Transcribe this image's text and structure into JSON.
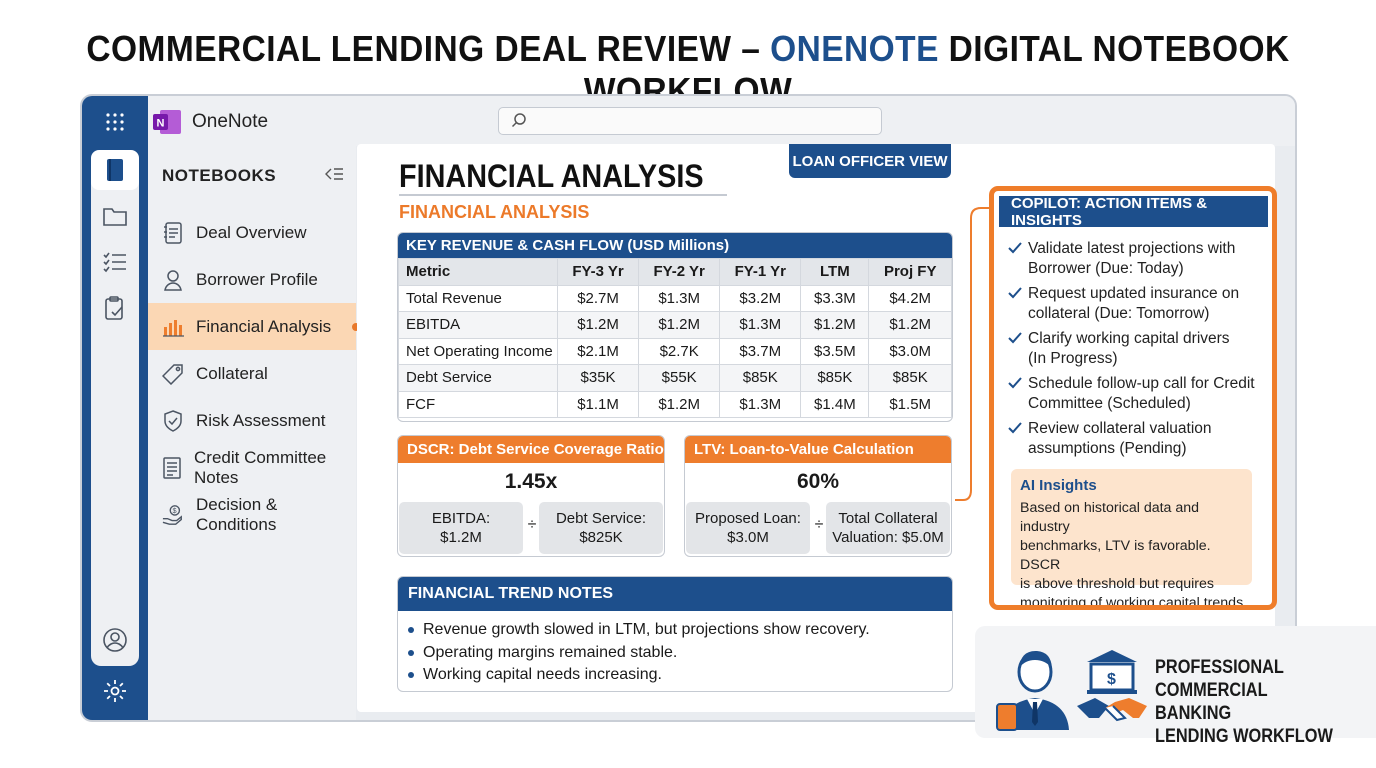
{
  "headline": {
    "part1": "COMMERCIAL LENDING DEAL REVIEW – ",
    "accent": "ONENOTE",
    "part2": " DIGITAL NOTEBOOK WORKFLOW"
  },
  "app": {
    "name": "OneNote",
    "search_placeholder": ""
  },
  "rail": {
    "icons": [
      "apps-grid-icon",
      "notebook-icon",
      "folder-icon",
      "checklist-icon",
      "clipboard-icon",
      "account-icon",
      "settings-icon"
    ]
  },
  "notebooks": {
    "heading": "NOTEBOOKS",
    "items": [
      {
        "label": "Deal Overview",
        "icon": "document-icon"
      },
      {
        "label": "Borrower Profile",
        "icon": "person-icon"
      },
      {
        "label": "Financial Analysis",
        "icon": "bar-chart-icon",
        "active": true
      },
      {
        "label": "Collateral",
        "icon": "tag-icon"
      },
      {
        "label": "Risk Assessment",
        "icon": "shield-check-icon"
      },
      {
        "label": "Credit Committee Notes",
        "icon": "notes-icon"
      },
      {
        "label": "Decision & Conditions",
        "icon": "hand-dollar-icon"
      }
    ]
  },
  "page": {
    "title": "FINANCIAL ANALYSIS",
    "subtitle": "FINANCIAL ANALYSIS",
    "view_badge": "LOAN OFFICER VIEW"
  },
  "revenue_table": {
    "title": "KEY REVENUE & CASH FLOW (USD Millions)",
    "columns": [
      "Metric",
      "FY-3 Yr",
      "FY-2 Yr",
      "FY-1 Yr",
      "LTM",
      "Proj FY"
    ],
    "rows": [
      [
        "Total Revenue",
        "$2.7M",
        "$1.3M",
        "$3.2M",
        "$3.3M",
        "$4.2M"
      ],
      [
        "EBITDA",
        "$1.2M",
        "$1.2M",
        "$1.3M",
        "$1.2M",
        "$1.2M"
      ],
      [
        "Net Operating Income",
        "$2.1M",
        "$2.7K",
        "$3.7M",
        "$3.5M",
        "$3.0M"
      ],
      [
        "Debt Service",
        "$35K",
        "$55K",
        "$85K",
        "$85K",
        "$85K"
      ],
      [
        "FCF",
        "$1.1M",
        "$1.2M",
        "$1.3M",
        "$1.4M",
        "$1.5M"
      ]
    ]
  },
  "dscr": {
    "title": "DSCR: Debt Service Coverage Ratio",
    "value": "1.45x",
    "left_label": "EBITDA:",
    "left_value": "$1.2M",
    "operator": "÷",
    "right_label": "Debt Service:",
    "right_value": "$825K"
  },
  "ltv": {
    "title": "LTV: Loan-to-Value Calculation",
    "value": "60%",
    "left_label": "Proposed Loan:",
    "left_value": "$3.0M",
    "operator": "÷",
    "right_label": "Total Collateral",
    "right_value": "Valuation: $5.0M"
  },
  "trend_notes": {
    "title": "FINANCIAL TREND NOTES",
    "items": [
      "Revenue growth slowed in LTM, but projections show recovery.",
      "Operating margins remained stable.",
      "Working capital needs increasing."
    ]
  },
  "copilot": {
    "title": "COPILOT: ACTION ITEMS & INSIGHTS",
    "items": [
      {
        "line1": "Validate latest projections with",
        "line2": "Borrower (Due: Today)"
      },
      {
        "line1": "Request updated insurance on",
        "line2": "collateral (Due: Tomorrow)"
      },
      {
        "line1": "Clarify working capital drivers",
        "line2": "(In Progress)"
      },
      {
        "line1": "Schedule follow-up call for Credit",
        "line2": "Committee (Scheduled)"
      },
      {
        "line1": "Review collateral valuation",
        "line2": "assumptions (Pending)"
      }
    ],
    "ai_title": "AI Insights",
    "ai_lines": [
      "Based on historical data and industry",
      "benchmarks, LTV is favorable. DSCR",
      "is above threshold but requires",
      "monitoring of working capital trends."
    ]
  },
  "footer": {
    "lines": [
      "PROFESSIONAL",
      "COMMERCIAL BANKING",
      "LENDING WORKFLOW"
    ],
    "icons": [
      "banker-icon",
      "bank-handshake-icon"
    ]
  },
  "colors": {
    "brand_blue": "#1d4f8c",
    "accent_orange": "#ee7d2d",
    "onenote_purple": "#7719aa"
  }
}
